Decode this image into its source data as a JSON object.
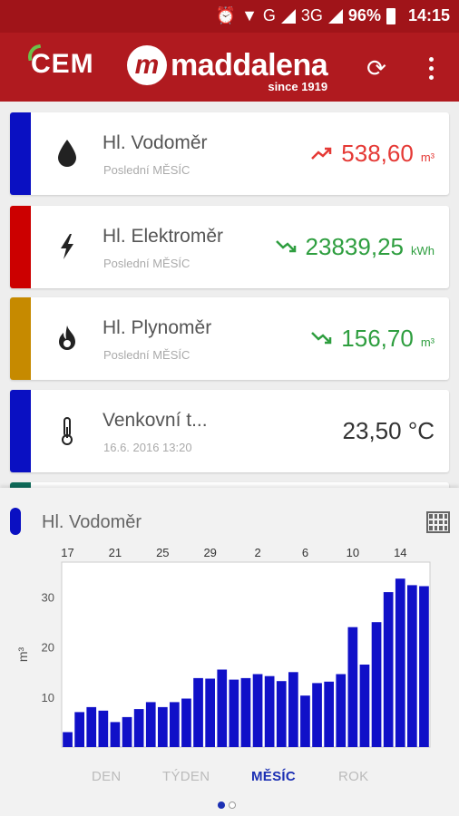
{
  "status_bar": {
    "battery": "96%",
    "time": "14:15",
    "network_1": "G",
    "network_2": "3G"
  },
  "app_bar": {
    "logo_left": "CEM",
    "brand_name": "maddalena",
    "brand_since": "since 1919"
  },
  "meters": [
    {
      "title": "Hl. Vodoměr",
      "subtitle": "Poslední MĚSÍC",
      "value": "538,60",
      "unit": "m³",
      "trend": "up",
      "stripe_color": "#0a10c2",
      "value_color": "#e53935",
      "icon": "water-drop-icon"
    },
    {
      "title": "Hl. Elektroměr",
      "subtitle": "Poslední MĚSÍC",
      "value": "23839,25",
      "unit": "kWh",
      "trend": "down",
      "stripe_color": "#cc0000",
      "value_color": "#2e9e3f",
      "icon": "lightning-icon"
    },
    {
      "title": "Hl. Plynoměr",
      "subtitle": "Poslední MĚSÍC",
      "value": "156,70",
      "unit": "m³",
      "trend": "down",
      "stripe_color": "#c68a00",
      "value_color": "#2e9e3f",
      "icon": "flame-icon"
    },
    {
      "title": "Venkovní t...",
      "subtitle": "16.6. 2016 13:20",
      "value": "23,50 °C",
      "unit": "",
      "trend": "none",
      "stripe_color": "#0a10c2",
      "value_color": "#333333",
      "icon": "thermometer-icon"
    }
  ],
  "chart_panel": {
    "title": "Hl. Vodoměr",
    "marker_color": "#0a10c2",
    "tabs": [
      "DEN",
      "TÝDEN",
      "MĚSÍC",
      "ROK"
    ],
    "active_tab": "MĚSÍC"
  },
  "chart_data": {
    "type": "bar",
    "title": "",
    "xlabel": "",
    "ylabel": "m³",
    "ylim": [
      0,
      37
    ],
    "yticks": [
      10,
      20,
      30
    ],
    "x_tick_labels": [
      "17",
      "21",
      "25",
      "29",
      "2",
      "6",
      "10",
      "14"
    ],
    "x_tick_indices": [
      0,
      4,
      8,
      12,
      16,
      20,
      24,
      28
    ],
    "bar_color": "#1010c8",
    "values": [
      3,
      7,
      8,
      7.3,
      5,
      6,
      7.6,
      9,
      8,
      9,
      9.7,
      13.8,
      13.7,
      15.5,
      13.5,
      13.8,
      14.6,
      14.2,
      13.2,
      15,
      10.3,
      12.8,
      13.1,
      14.6,
      24,
      16.5,
      25,
      31,
      33.7,
      32.4,
      32.2
    ]
  }
}
